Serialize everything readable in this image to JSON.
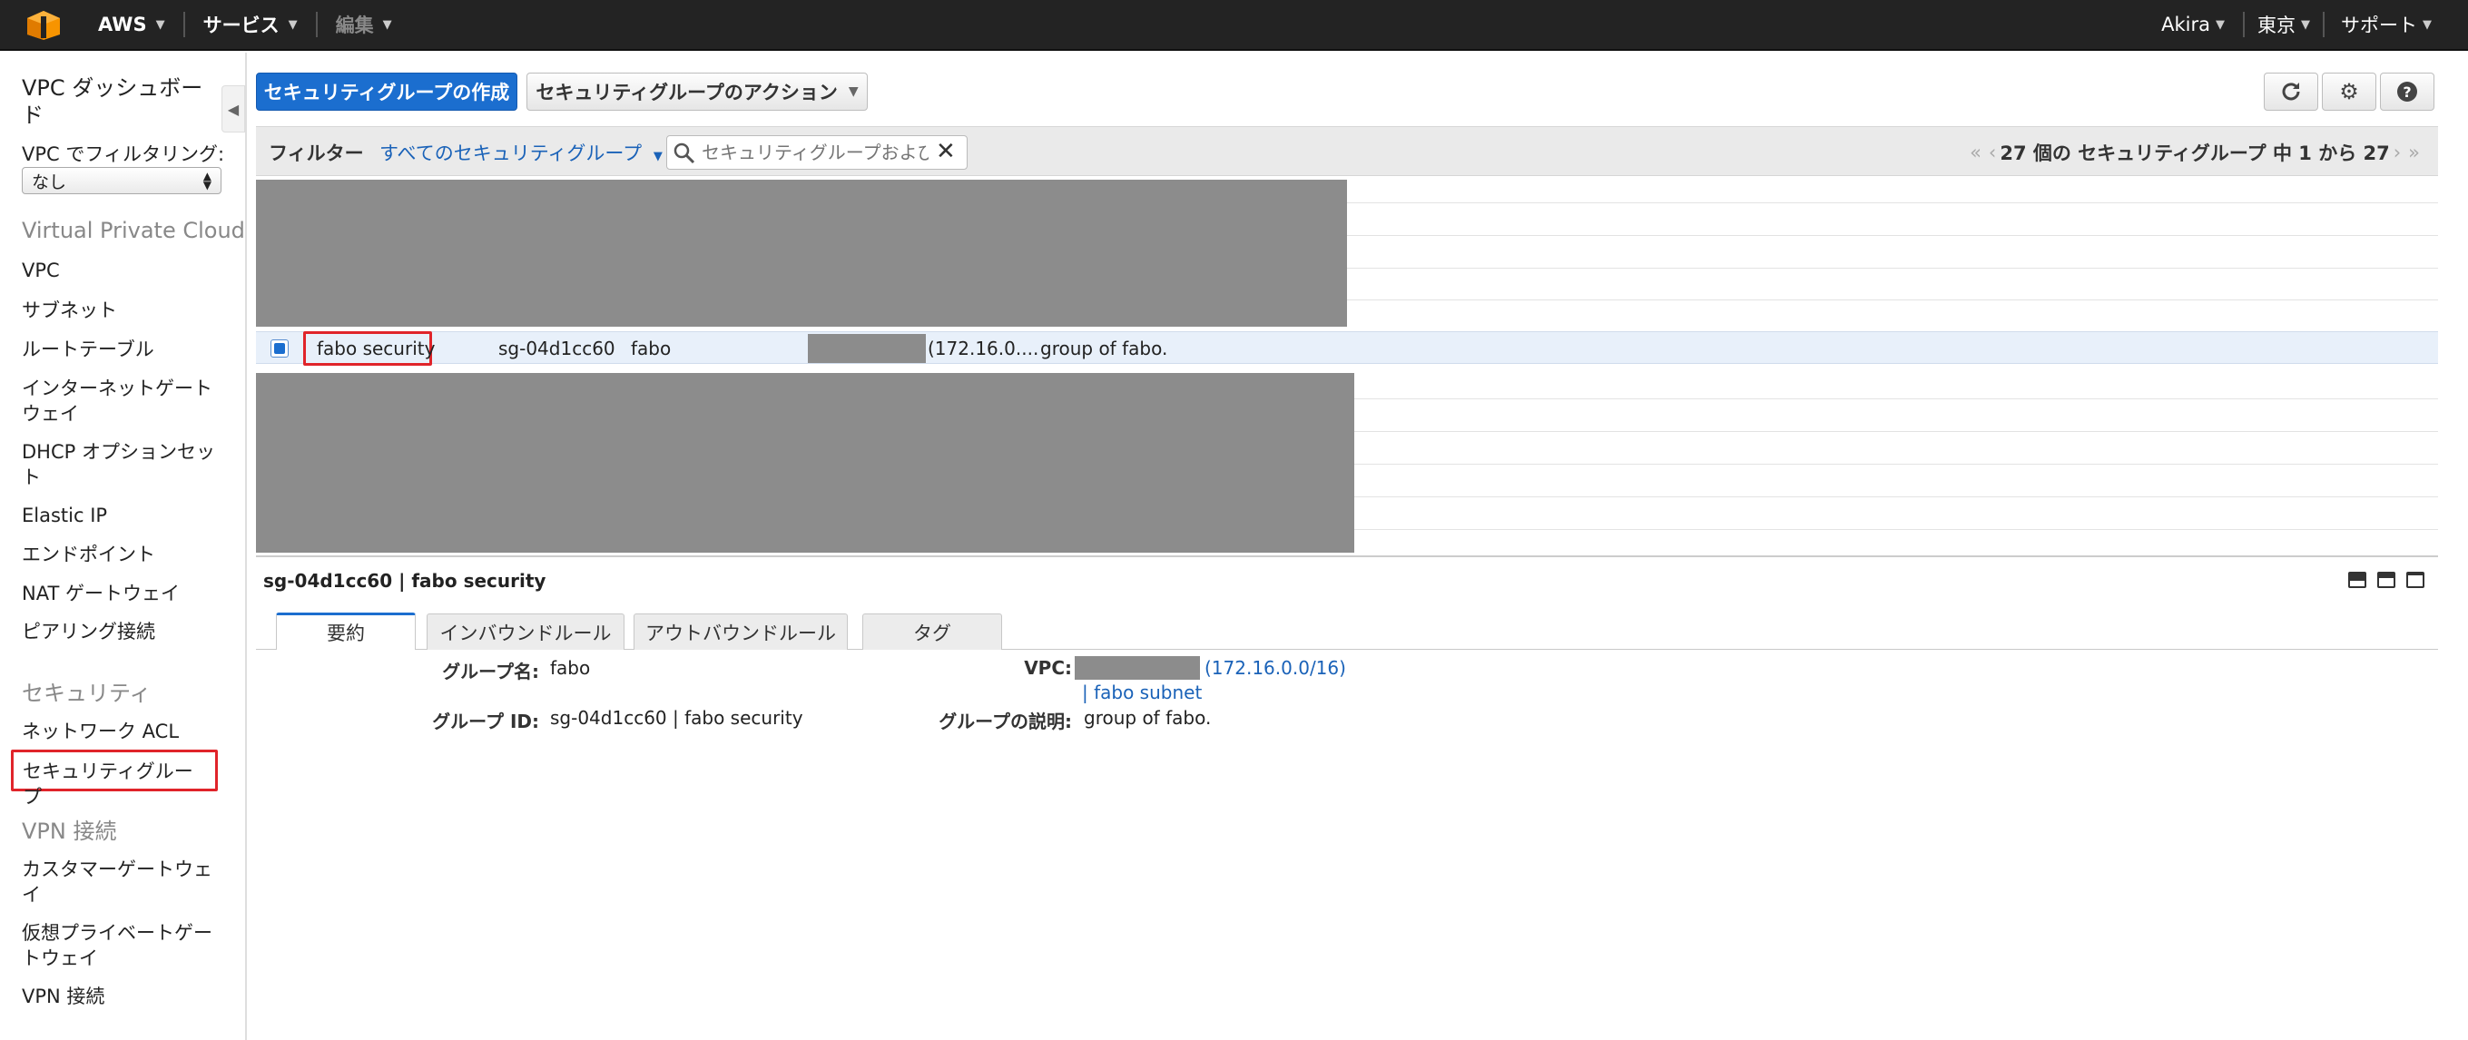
{
  "topnav": {
    "brand": "AWS",
    "services": "サービス",
    "edit": "編集",
    "user": "Akira",
    "region": "東京",
    "support": "サポート"
  },
  "sidebar": {
    "dashboard": "VPC ダッシュボード",
    "filter_label": "VPC でフィルタリング:",
    "filter_value": "なし",
    "sections": [
      {
        "title": "Virtual Private Cloud",
        "items": [
          "VPC",
          "サブネット",
          "ルートテーブル",
          "インターネットゲートウェイ",
          "DHCP オプションセット",
          "Elastic IP",
          "エンドポイント",
          "NAT ゲートウェイ",
          "ピアリング接続"
        ]
      },
      {
        "title": "セキュリティ",
        "items": [
          "ネットワーク ACL",
          "セキュリティグループ"
        ]
      },
      {
        "title": "VPN 接続",
        "items": [
          "カスタマーゲートウェイ",
          "仮想プライベートゲートウェイ",
          "VPN 接続"
        ]
      }
    ]
  },
  "toolbar": {
    "create": "セキュリティグループの作成",
    "actions": "セキュリティグループのアクション",
    "icons": [
      "refresh-icon",
      "gear-icon",
      "help-icon"
    ]
  },
  "filter": {
    "label": "フィルター",
    "dropdown": "すべてのセキュリティグループ",
    "placeholder": "セキュリティグループおよび",
    "pagination": "27 個の セキュリティグループ 中 1 から 27"
  },
  "table": {
    "selected_row": {
      "name": "fabo security",
      "group_id": "sg-04d1cc60",
      "group_name": "fabo",
      "vpc": "(172.16.0....",
      "description": "group of fabo."
    }
  },
  "details": {
    "title": "sg-04d1cc60 | fabo security",
    "tabs": [
      "要約",
      "インバウンドルール",
      "アウトバウンドルール",
      "タグ"
    ],
    "fields": {
      "group_name_label": "グループ名:",
      "group_name_value": "fabo",
      "group_id_label": "グループ ID:",
      "group_id_value": "sg-04d1cc60 | fabo security",
      "vpc_label": "VPC:",
      "vpc_cidr": "(172.16.0.0/16)",
      "vpc_subnet": "| fabo subnet",
      "desc_label": "グループの説明:",
      "desc_value": "group of fabo."
    }
  },
  "colors": {
    "nav_bg": "#232323",
    "primary": "#1b6ecf",
    "link": "#1a62b8",
    "highlight": "#e0242a",
    "redaction": "#8c8c8c"
  }
}
